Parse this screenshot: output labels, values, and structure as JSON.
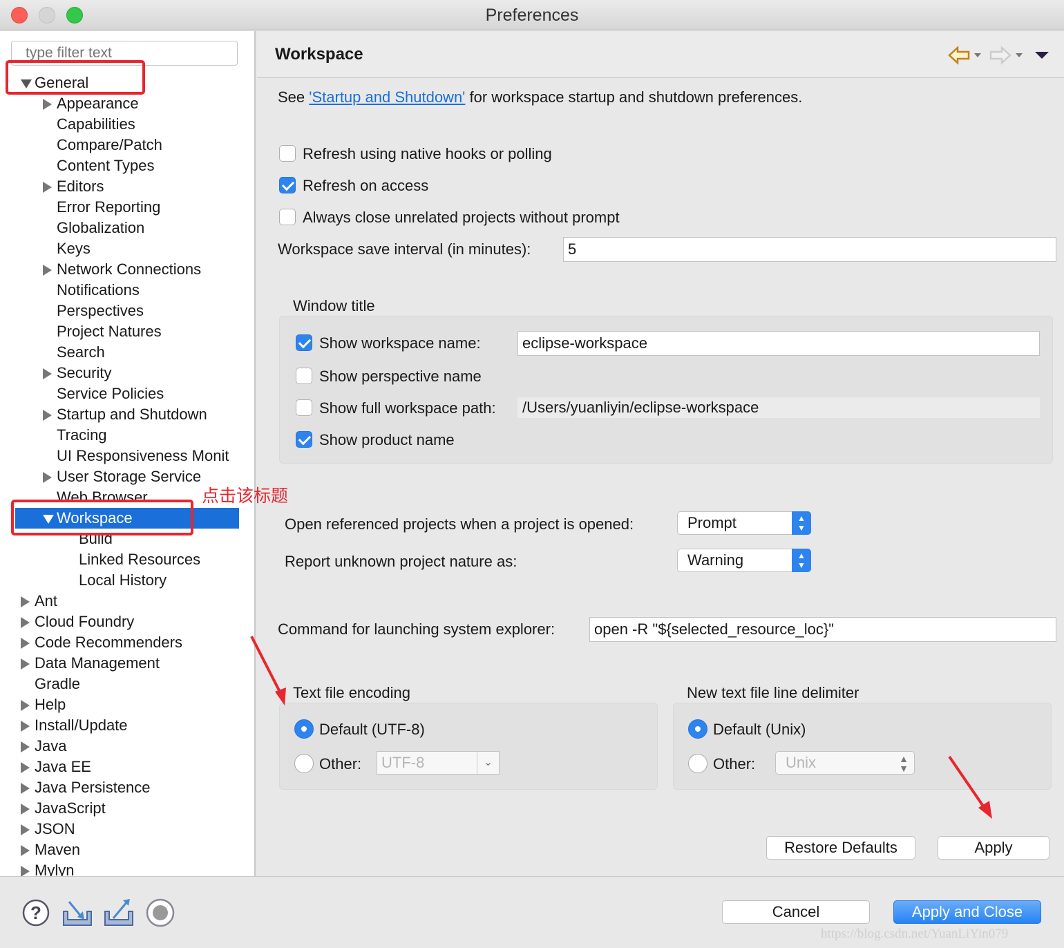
{
  "window": {
    "title": "Preferences"
  },
  "sidebar": {
    "filter_placeholder": "type filter text",
    "items": [
      {
        "label": "General",
        "level": 0,
        "arrow": "open"
      },
      {
        "label": "Appearance",
        "level": 1,
        "arrow": "closed"
      },
      {
        "label": "Capabilities",
        "level": 1,
        "arrow": "none"
      },
      {
        "label": "Compare/Patch",
        "level": 1,
        "arrow": "none"
      },
      {
        "label": "Content Types",
        "level": 1,
        "arrow": "none"
      },
      {
        "label": "Editors",
        "level": 1,
        "arrow": "closed"
      },
      {
        "label": "Error Reporting",
        "level": 1,
        "arrow": "none"
      },
      {
        "label": "Globalization",
        "level": 1,
        "arrow": "none"
      },
      {
        "label": "Keys",
        "level": 1,
        "arrow": "none"
      },
      {
        "label": "Network Connections",
        "level": 1,
        "arrow": "closed"
      },
      {
        "label": "Notifications",
        "level": 1,
        "arrow": "none"
      },
      {
        "label": "Perspectives",
        "level": 1,
        "arrow": "none"
      },
      {
        "label": "Project Natures",
        "level": 1,
        "arrow": "none"
      },
      {
        "label": "Search",
        "level": 1,
        "arrow": "none"
      },
      {
        "label": "Security",
        "level": 1,
        "arrow": "closed"
      },
      {
        "label": "Service Policies",
        "level": 1,
        "arrow": "none"
      },
      {
        "label": "Startup and Shutdown",
        "level": 1,
        "arrow": "closed"
      },
      {
        "label": "Tracing",
        "level": 1,
        "arrow": "none"
      },
      {
        "label": "UI Responsiveness Monit",
        "level": 1,
        "arrow": "none"
      },
      {
        "label": "User Storage Service",
        "level": 1,
        "arrow": "closed"
      },
      {
        "label": "Web Browser",
        "level": 1,
        "arrow": "none"
      },
      {
        "label": "Workspace",
        "level": 1,
        "arrow": "open",
        "selected": true
      },
      {
        "label": "Build",
        "level": 2,
        "arrow": "none"
      },
      {
        "label": "Linked Resources",
        "level": 2,
        "arrow": "none"
      },
      {
        "label": "Local History",
        "level": 2,
        "arrow": "none"
      },
      {
        "label": "Ant",
        "level": 0,
        "arrow": "closed"
      },
      {
        "label": "Cloud Foundry",
        "level": 0,
        "arrow": "closed"
      },
      {
        "label": "Code Recommenders",
        "level": 0,
        "arrow": "closed"
      },
      {
        "label": "Data Management",
        "level": 0,
        "arrow": "closed"
      },
      {
        "label": "Gradle",
        "level": 0,
        "arrow": "none"
      },
      {
        "label": "Help",
        "level": 0,
        "arrow": "closed"
      },
      {
        "label": "Install/Update",
        "level": 0,
        "arrow": "closed"
      },
      {
        "label": "Java",
        "level": 0,
        "arrow": "closed"
      },
      {
        "label": "Java EE",
        "level": 0,
        "arrow": "closed"
      },
      {
        "label": "Java Persistence",
        "level": 0,
        "arrow": "closed"
      },
      {
        "label": "JavaScript",
        "level": 0,
        "arrow": "closed"
      },
      {
        "label": "JSON",
        "level": 0,
        "arrow": "closed"
      },
      {
        "label": "Maven",
        "level": 0,
        "arrow": "closed"
      },
      {
        "label": "Mylyn",
        "level": 0,
        "arrow": "closed"
      }
    ],
    "annotation": "点击该标题"
  },
  "main": {
    "title": "Workspace",
    "intro_pre": "See ",
    "intro_link": "'Startup and Shutdown'",
    "intro_post": " for workspace startup and shutdown preferences.",
    "refresh_native": {
      "label": "Refresh using native hooks or polling",
      "checked": false
    },
    "refresh_access": {
      "label": "Refresh on access",
      "checked": true
    },
    "always_close": {
      "label": "Always close unrelated projects without prompt",
      "checked": false
    },
    "save_interval": {
      "label": "Workspace save interval (in minutes):",
      "value": "5"
    },
    "window_title": {
      "group_label": "Window title",
      "show_workspace_name": {
        "label": "Show workspace name:",
        "checked": true,
        "value": "eclipse-workspace"
      },
      "show_perspective_name": {
        "label": "Show perspective name",
        "checked": false
      },
      "show_full_path": {
        "label": "Show full workspace path:",
        "checked": false,
        "value": "/Users/yuanliyin/eclipse-workspace"
      },
      "show_product_name": {
        "label": "Show product name",
        "checked": true
      }
    },
    "open_referenced": {
      "label": "Open referenced projects when a project is opened:",
      "value": "Prompt"
    },
    "report_unknown": {
      "label": "Report unknown project nature as:",
      "value": "Warning"
    },
    "command": {
      "label": "Command for launching system explorer:",
      "value": "open -R \"${selected_resource_loc}\""
    },
    "encoding": {
      "group_label": "Text file encoding",
      "default_label": "Default (UTF-8)",
      "other_label": "Other:",
      "other_value": "UTF-8",
      "selected": "default"
    },
    "delimiter": {
      "group_label": "New text file line delimiter",
      "default_label": "Default (Unix)",
      "other_label": "Other:",
      "other_value": "Unix",
      "selected": "default"
    },
    "restore_defaults": "Restore Defaults",
    "apply": "Apply"
  },
  "footer": {
    "cancel": "Cancel",
    "apply_close": "Apply and Close",
    "watermark": "https://blog.csdn.net/YuanLiYin079"
  },
  "colors": {
    "accent": "#2d84ee",
    "selection": "#1a6fd9",
    "annotation": "#e8262e",
    "link": "#1a6fd9"
  }
}
